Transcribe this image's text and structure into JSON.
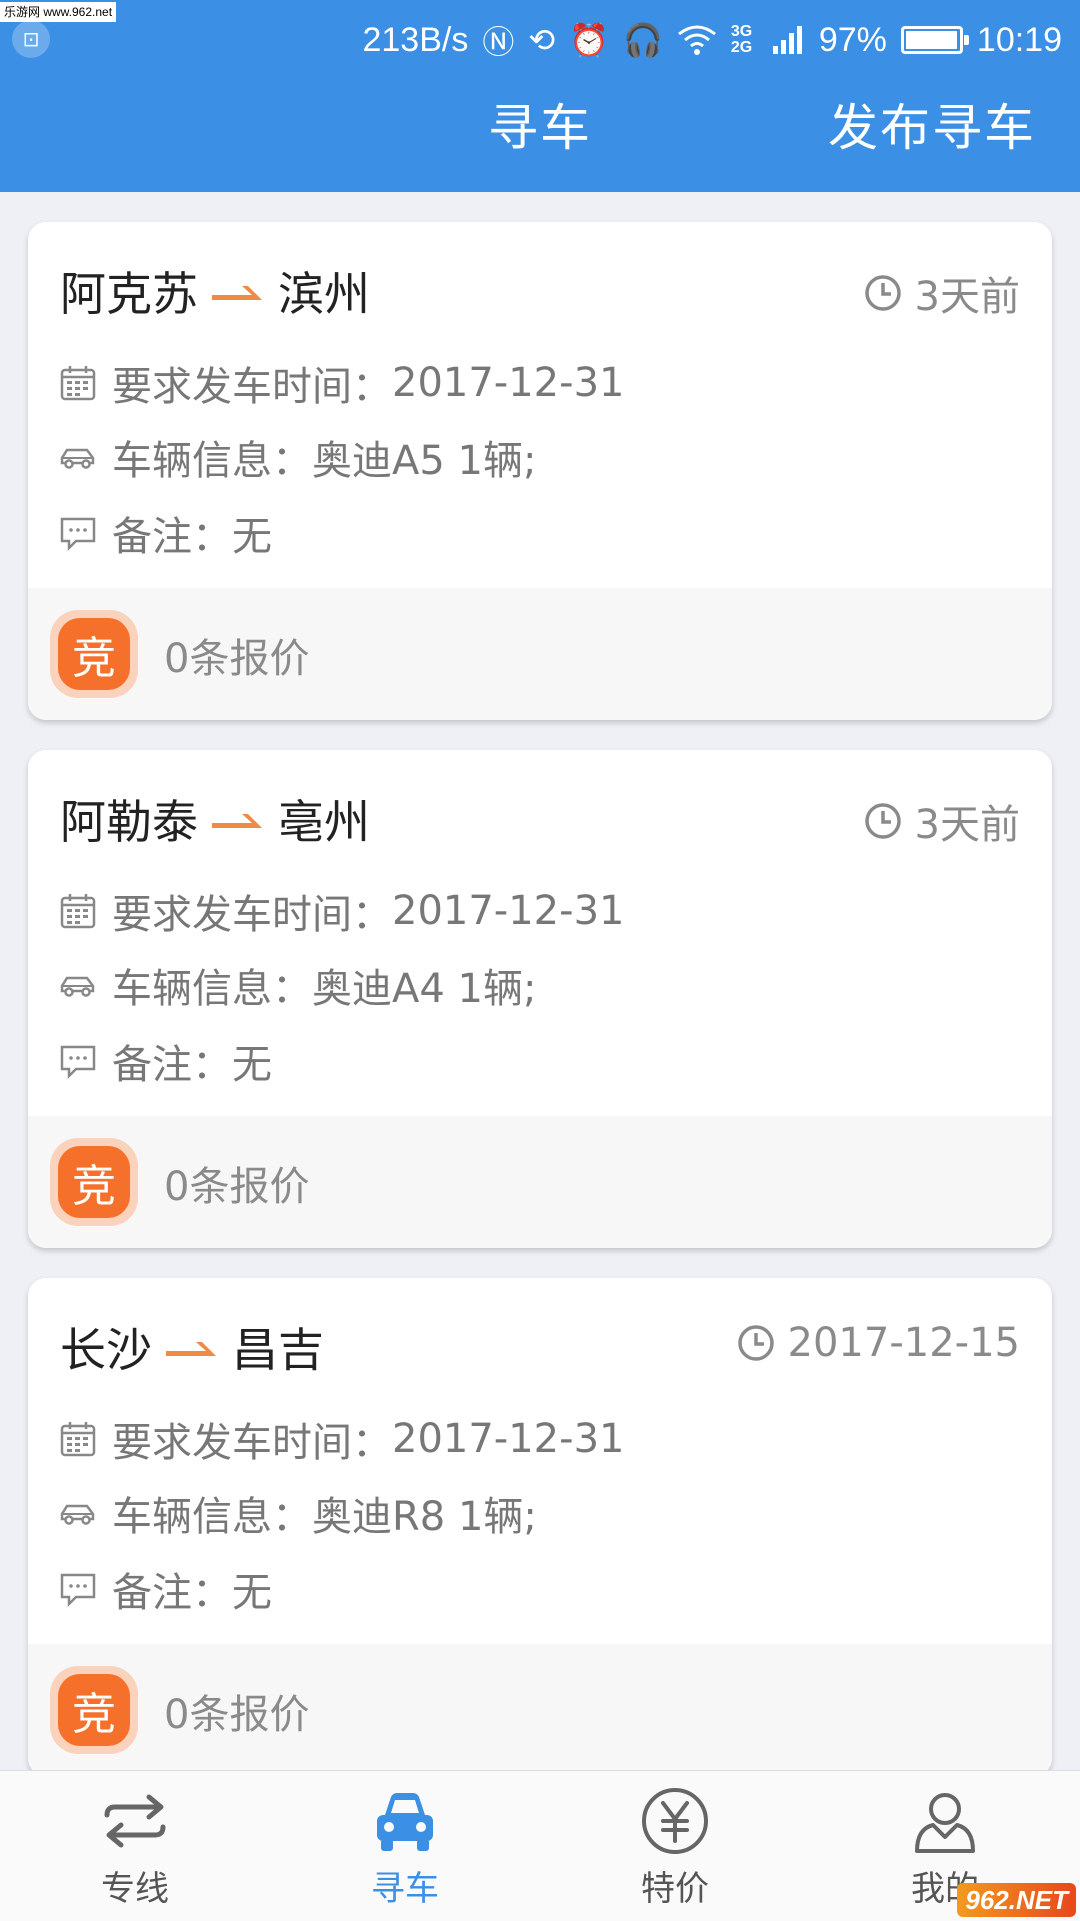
{
  "status_bar": {
    "site_badge": "乐游网 www.962.net",
    "net_speed": "213B/s",
    "network": "3G 2G",
    "battery": "97%",
    "time": "10:19"
  },
  "header": {
    "title": "寻车",
    "publish_label": "发布寻车"
  },
  "labels": {
    "depart_time": "要求发车时间：",
    "vehicle_info": "车辆信息：",
    "remark": "备注："
  },
  "cards": [
    {
      "from": "阿克苏",
      "to": "滨州",
      "posted": "3天前",
      "depart_date": "2017-12-31",
      "vehicle": "奥迪A5 1辆;",
      "remark": "无",
      "bid_icon": "竞",
      "bid_count": "0条报价"
    },
    {
      "from": "阿勒泰",
      "to": "亳州",
      "posted": "3天前",
      "depart_date": "2017-12-31",
      "vehicle": "奥迪A4 1辆;",
      "remark": "无",
      "bid_icon": "竞",
      "bid_count": "0条报价"
    },
    {
      "from": "长沙",
      "to": "昌吉",
      "posted": "2017-12-15",
      "depart_date": "2017-12-31",
      "vehicle": "奥迪R8 1辆;",
      "remark": "无",
      "bid_icon": "竞",
      "bid_count": "0条报价"
    }
  ],
  "nav": {
    "items": [
      {
        "label": "专线",
        "icon": "swap-arrows-icon"
      },
      {
        "label": "寻车",
        "icon": "car-icon"
      },
      {
        "label": "特价",
        "icon": "yen-icon"
      },
      {
        "label": "我的",
        "icon": "user-icon"
      }
    ],
    "active_index": 1
  },
  "watermark": "962.NET",
  "colors": {
    "header_blue": "#3b8fe4",
    "accent_orange": "#f4702b",
    "background": "#eef0f6"
  }
}
